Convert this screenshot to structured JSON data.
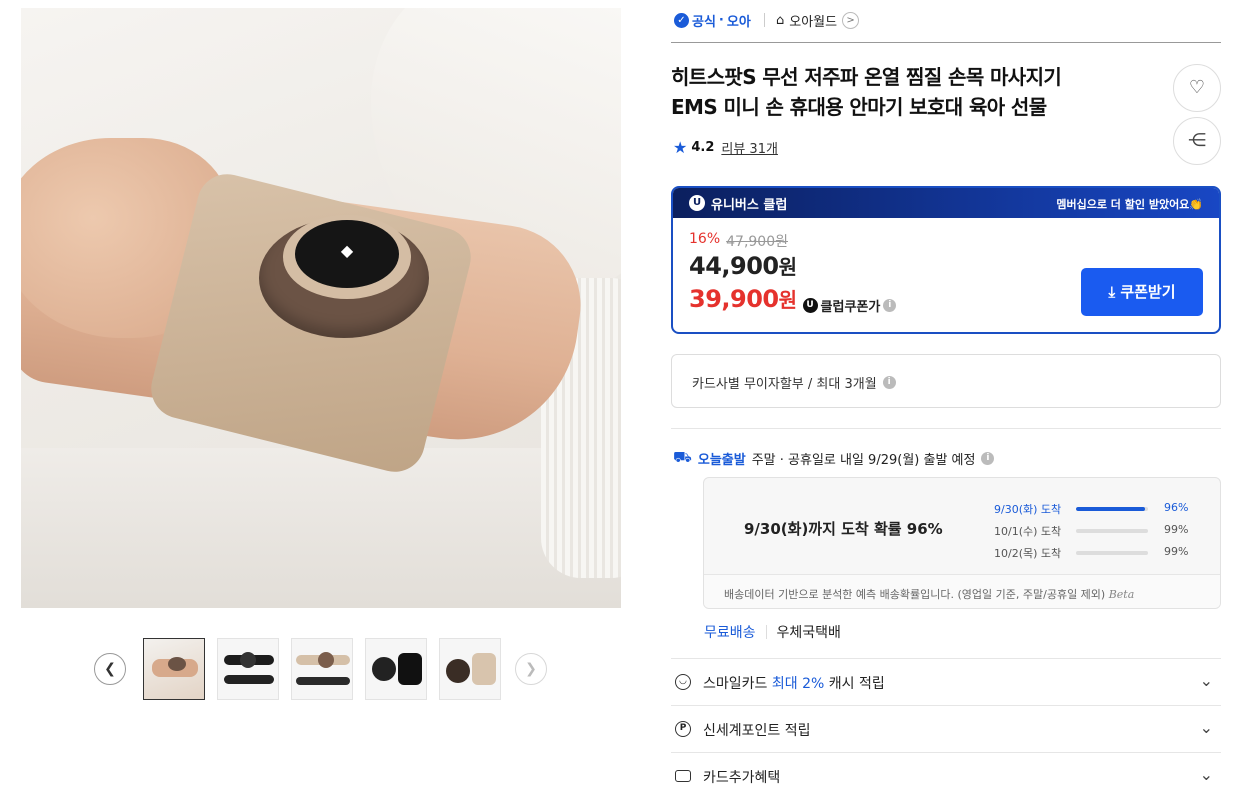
{
  "store": {
    "official_label": "공식",
    "store_name": "오아",
    "world_link": "오아월드"
  },
  "product": {
    "title_line1": "히트스팟S 무선 저주파 온열 찜질 손목 마사지기",
    "title_line2": "EMS 미니 손 휴대용 안마기 보호대 육아 선물",
    "rating": "4.2",
    "review_label": "리뷰 31개"
  },
  "club": {
    "name": "유니버스 클럽",
    "member_text": "멤버십으로 더 할인 받았어요👏",
    "discount_pct": "16%",
    "original_price": "47,900원",
    "sale_price": "44,900",
    "club_price": "39,900",
    "won": "원",
    "coupon_label": "클럽쿠폰가",
    "coupon_button": "쿠폰받기"
  },
  "installment": {
    "text": "카드사별 무이자할부 / 최대 3개월"
  },
  "delivery": {
    "today_label": "오늘출발",
    "schedule_text": "주말 · 공휴일로 내일 9/29(월) 출발 예정",
    "headline": "9/30(화)까지 도착 확률 96%",
    "probabilities": [
      {
        "day": "9/30(화) 도착",
        "value": 96,
        "label": "96%"
      },
      {
        "day": "10/1(수) 도착",
        "value": 99,
        "label": "99%"
      },
      {
        "day": "10/2(목) 도착",
        "value": 99,
        "label": "99%"
      }
    ],
    "note": "배송데이터 기반으로 분석한 예측 배송확률입니다. (영업일 기준, 주말/공휴일 제외)",
    "beta": "Beta",
    "free_shipping": "무료배송",
    "carrier": "우체국택배"
  },
  "benefits": {
    "smile_prefix": "스마일카드",
    "smile_highlight": "최대 2%",
    "smile_suffix": "캐시 적립",
    "shinsegae": "신세계포인트 적립",
    "card_extra": "카드추가혜택"
  }
}
